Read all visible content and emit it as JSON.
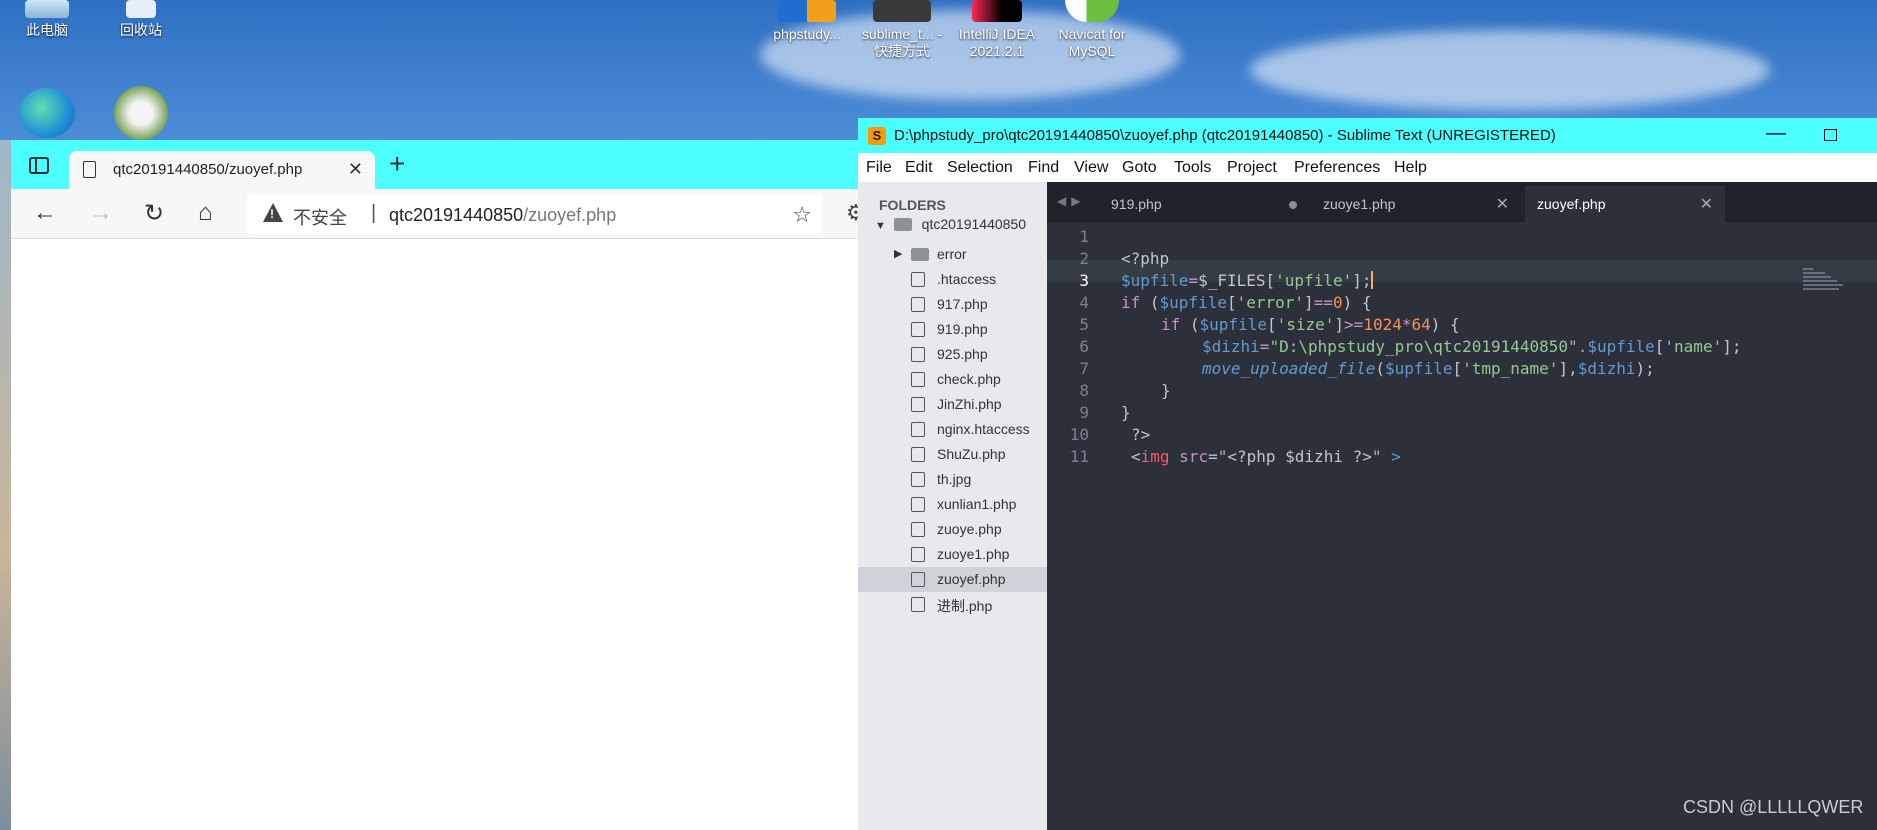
{
  "desktop": {
    "icons": [
      {
        "label": "此电脑",
        "icon": "this-pc-icon"
      },
      {
        "label": "回收站",
        "icon": "recycle-bin-icon"
      },
      {
        "label": "phpstudy...",
        "icon": "phpstudy-icon"
      },
      {
        "label": "sublime_t... - 快捷方式",
        "icon": "sublime-shortcut-icon"
      },
      {
        "label": "IntelliJ IDEA 2021.2.1",
        "icon": "intellij-icon"
      },
      {
        "label": "Navicat for MySQL",
        "icon": "navicat-icon"
      }
    ]
  },
  "browser": {
    "tab_title": "qtc20191440850/zuoyef.php",
    "tab_close": "✕",
    "new_tab": "+",
    "back": "←",
    "forward": "→",
    "reload": "↻",
    "home": "⌂",
    "security_label": "不安全",
    "separator": "|",
    "url_host": "qtc20191440850",
    "url_path": "/zuoyef.php",
    "favorite": "☆",
    "extension": "⚙"
  },
  "sublime": {
    "title": "D:\\phpstudy_pro\\qtc20191440850\\zuoyef.php (qtc20191440850) - Sublime Text (UNREGISTERED)",
    "minimize": "—",
    "menu": [
      "File",
      "Edit",
      "Selection",
      "Find",
      "View",
      "Goto",
      "Tools",
      "Project",
      "Preferences",
      "Help"
    ],
    "sidebar": {
      "header": "FOLDERS",
      "root": "qtc20191440850",
      "items": [
        {
          "name": "error",
          "type": "folder"
        },
        {
          "name": ".htaccess",
          "type": "file"
        },
        {
          "name": "917.php",
          "type": "file"
        },
        {
          "name": "919.php",
          "type": "file"
        },
        {
          "name": "925.php",
          "type": "file"
        },
        {
          "name": "check.php",
          "type": "file"
        },
        {
          "name": "JinZhi.php",
          "type": "file"
        },
        {
          "name": "nginx.htaccess",
          "type": "file"
        },
        {
          "name": "ShuZu.php",
          "type": "file"
        },
        {
          "name": "th.jpg",
          "type": "file"
        },
        {
          "name": "xunlian1.php",
          "type": "file"
        },
        {
          "name": "zuoye.php",
          "type": "file"
        },
        {
          "name": "zuoye1.php",
          "type": "file"
        },
        {
          "name": "zuoyef.php",
          "type": "file",
          "selected": true
        },
        {
          "name": "进制.php",
          "type": "file"
        }
      ]
    },
    "tabs": [
      {
        "label": "919.php",
        "dirty": true
      },
      {
        "label": "zuoye1.php",
        "dirty": false
      },
      {
        "label": "zuoyef.php",
        "dirty": false,
        "active": true
      }
    ],
    "line_numbers": [
      "1",
      "2",
      "3",
      "4",
      "5",
      "6",
      "7",
      "8",
      "9",
      "10",
      "11"
    ],
    "current_line": 3,
    "code": {
      "l2": "<?php",
      "l3a": "$upfile",
      "l3b": "=",
      "l3c": "$_FILES",
      "l3d": "[",
      "l3e": "'upfile'",
      "l3f": "];",
      "l4a": "if",
      "l4b": " (",
      "l4c": "$upfile",
      "l4d": "[",
      "l4e": "'error'",
      "l4f": "]",
      "l4g": "==",
      "l4h": "0",
      "l4i": ") {",
      "l5a": "if",
      "l5b": " (",
      "l5c": "$upfile",
      "l5d": "[",
      "l5e": "'size'",
      "l5f": "]",
      "l5g": ">=",
      "l5h": "1024",
      "l5i": "*",
      "l5j": "64",
      "l5k": ") {",
      "l6a": "$dizhi",
      "l6b": "=",
      "l6c": "\"D:\\phpstudy_pro\\qtc20191440850\"",
      "l6d": ".",
      "l6e": "$upfile",
      "l6f": "[",
      "l6g": "'name'",
      "l6h": "];",
      "l7a": "move_uploaded_file",
      "l7b": "(",
      "l7c": "$upfile",
      "l7d": "[",
      "l7e": "'tmp_name'",
      "l7f": "],",
      "l7g": "$dizhi",
      "l7h": ");",
      "l8": "}",
      "l9": "}",
      "l10": "?>",
      "l11a": "<",
      "l11b": "img",
      "l11c": " src",
      "l11d": "=",
      "l11e": "\"",
      "l11f": "<?php $dizhi ?>",
      "l11g": "\"",
      "l11h": " >"
    }
  },
  "watermark": "CSDN @LLLLLQWER",
  "colors": {
    "titlebar_accent": "#4dfefe",
    "editor_bg": "#2b303b"
  }
}
